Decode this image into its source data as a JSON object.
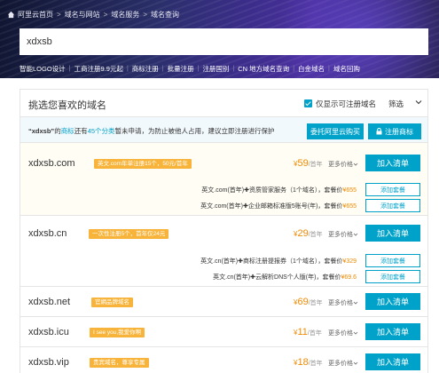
{
  "breadcrumb": [
    "阿里云首页",
    "域名与网站",
    "域名服务",
    "域名查询"
  ],
  "search": {
    "value": "xdxsb"
  },
  "quicklinks": [
    "智能LOGO设计",
    "工商注册9.9元起",
    "商标注册",
    "批量注册",
    "注册国别",
    "CN 地方域名查询",
    "白金域名",
    "域名回购"
  ],
  "panel": {
    "title": "挑选您喜欢的域名",
    "filter_label": "仅显示可注册域名",
    "filter_btn": "筛选"
  },
  "notice": {
    "quote": "“xdxsb”",
    "text1": "的",
    "hl1": "商标",
    "text2": "还有",
    "hl2": "45个分类",
    "text3": "暂未申请，为防止被他人占用，建议立即注册进行保护",
    "buy_btn": "委托阿里云购买",
    "reg_btn": "注册商标"
  },
  "domains": [
    {
      "name": "xdxsb.com",
      "tag": "英文.com年单注册15个，50元/首年",
      "price": "59",
      "yen": "¥",
      "unit": "/首年",
      "more": "更多价格",
      "add": "加入清单",
      "packages": [
        {
          "a": "英文.com(首年)",
          "b": "资质管家服务（1个域名），套餐价",
          "price": "¥655",
          "btn": "添加套餐"
        },
        {
          "a": "英文.com(首年)",
          "b": "企业邮箱标准版5账号(年)，套餐价",
          "price": "¥655",
          "btn": "添加套餐"
        }
      ]
    },
    {
      "name": "xdxsb.cn",
      "tag": "一次性注册5个，首年仅24元",
      "price": "29",
      "yen": "¥",
      "unit": "/首年",
      "more": "更多价格",
      "add": "加入清单",
      "packages": [
        {
          "a": "英文.cn(首年)",
          "b": "商标注册提报券（1个域名），套餐价",
          "price": "¥329",
          "btn": "添加套餐"
        },
        {
          "a": "英文.cn(首年)",
          "b": "云解析DNS个人版(年)，套餐价",
          "price": "¥69.6",
          "btn": "添加套餐"
        }
      ]
    },
    {
      "name": "xdxsb.net",
      "tag": "官網品牌域名",
      "price": "69",
      "yen": "¥",
      "unit": "/首年",
      "more": "更多价格",
      "add": "加入清单",
      "packages": []
    },
    {
      "name": "xdxsb.icu",
      "tag": "I see you,我爱你啊",
      "price": "11",
      "yen": "¥",
      "unit": "/首年",
      "more": "更多价格",
      "add": "加入清单",
      "packages": []
    },
    {
      "name": "xdxsb.vip",
      "tag": "贵宾域名，尊享专属",
      "price": "18",
      "yen": "¥",
      "unit": "/首年",
      "more": "更多价格",
      "add": "加入清单",
      "packages": []
    }
  ]
}
